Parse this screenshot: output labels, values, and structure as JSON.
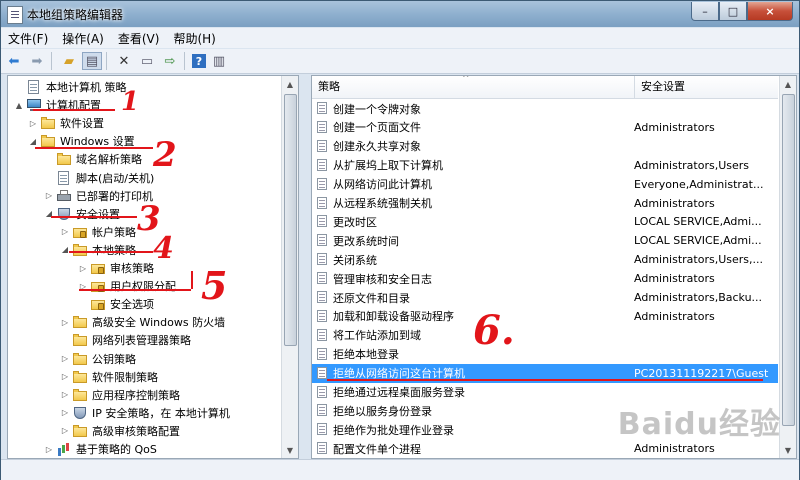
{
  "window": {
    "title": "本地组策略编辑器",
    "controls": {
      "minimize": "–",
      "maximize": "□",
      "close": "×"
    }
  },
  "menu": [
    "文件(F)",
    "操作(A)",
    "查看(V)",
    "帮助(H)"
  ],
  "toolbar": {
    "icons": [
      "back-icon",
      "forward-icon",
      "up-folder-icon",
      "show-tree-icon",
      "delete-icon",
      "properties-icon",
      "export-icon",
      "help-icon",
      "help-panel-icon"
    ]
  },
  "tree": [
    {
      "label": "本地计算机 策略",
      "icon": "doc",
      "depth": 0,
      "arrow": ""
    },
    {
      "label": "计算机配置",
      "icon": "computer",
      "depth": 0,
      "arrow": "▲"
    },
    {
      "label": "软件设置",
      "icon": "folder",
      "depth": 1,
      "arrow": "▷"
    },
    {
      "label": "Windows 设置",
      "icon": "folder",
      "depth": 1,
      "arrow": "◢"
    },
    {
      "label": "域名解析策略",
      "icon": "folder",
      "depth": 2,
      "arrow": ""
    },
    {
      "label": "脚本(启动/关机)",
      "icon": "doc",
      "depth": 2,
      "arrow": ""
    },
    {
      "label": "已部署的打印机",
      "icon": "printer",
      "depth": 2,
      "arrow": "▷"
    },
    {
      "label": "安全设置",
      "icon": "shield",
      "depth": 2,
      "arrow": "◢"
    },
    {
      "label": "帐户策略",
      "icon": "lockfolder",
      "depth": 3,
      "arrow": "▷"
    },
    {
      "label": "本地策略",
      "icon": "folder",
      "depth": 3,
      "arrow": "◢"
    },
    {
      "label": "审核策略",
      "icon": "lockfolder",
      "depth": 4,
      "arrow": "▷"
    },
    {
      "label": "用户权限分配",
      "icon": "lockfolder",
      "depth": 4,
      "arrow": "▷"
    },
    {
      "label": "安全选项",
      "icon": "lockfolder",
      "depth": 4,
      "arrow": ""
    },
    {
      "label": "高级安全 Windows 防火墙",
      "icon": "folder",
      "depth": 3,
      "arrow": "▷"
    },
    {
      "label": "网络列表管理器策略",
      "icon": "folder",
      "depth": 3,
      "arrow": ""
    },
    {
      "label": "公钥策略",
      "icon": "folder",
      "depth": 3,
      "arrow": "▷"
    },
    {
      "label": "软件限制策略",
      "icon": "folder",
      "depth": 3,
      "arrow": "▷"
    },
    {
      "label": "应用程序控制策略",
      "icon": "folder",
      "depth": 3,
      "arrow": "▷"
    },
    {
      "label": "IP 安全策略，在 本地计算机",
      "icon": "shield",
      "depth": 3,
      "arrow": "▷"
    },
    {
      "label": "高级审核策略配置",
      "icon": "folder",
      "depth": 3,
      "arrow": "▷"
    },
    {
      "label": "基于策略的 QoS",
      "icon": "chart",
      "depth": 2,
      "arrow": "▷"
    }
  ],
  "list": {
    "columns": [
      "策略",
      "安全设置"
    ],
    "rows": [
      {
        "policy": "创建一个令牌对象",
        "setting": ""
      },
      {
        "policy": "创建一个页面文件",
        "setting": "Administrators"
      },
      {
        "policy": "创建永久共享对象",
        "setting": ""
      },
      {
        "policy": "从扩展坞上取下计算机",
        "setting": "Administrators,Users"
      },
      {
        "policy": "从网络访问此计算机",
        "setting": "Everyone,Administrat..."
      },
      {
        "policy": "从远程系统强制关机",
        "setting": "Administrators"
      },
      {
        "policy": "更改时区",
        "setting": "LOCAL SERVICE,Admi..."
      },
      {
        "policy": "更改系统时间",
        "setting": "LOCAL SERVICE,Admi..."
      },
      {
        "policy": "关闭系统",
        "setting": "Administrators,Users,..."
      },
      {
        "policy": "管理审核和安全日志",
        "setting": "Administrators"
      },
      {
        "policy": "还原文件和目录",
        "setting": "Administrators,Backu..."
      },
      {
        "policy": "加载和卸载设备驱动程序",
        "setting": "Administrators"
      },
      {
        "policy": "将工作站添加到域",
        "setting": ""
      },
      {
        "policy": "拒绝本地登录",
        "setting": ""
      },
      {
        "policy": "拒绝从网络访问这台计算机",
        "setting": "PC201311192217\\Guest",
        "selected": true
      },
      {
        "policy": "拒绝通过远程桌面服务登录",
        "setting": ""
      },
      {
        "policy": "拒绝以服务身份登录",
        "setting": ""
      },
      {
        "policy": "拒绝作为批处理作业登录",
        "setting": ""
      },
      {
        "policy": "配置文件单个进程",
        "setting": "Administrators"
      }
    ]
  },
  "annotations": {
    "numbers": [
      "1",
      "2",
      "3",
      "4",
      "5",
      "6."
    ],
    "color": "#e2151a"
  },
  "watermark": "Baidu经验"
}
